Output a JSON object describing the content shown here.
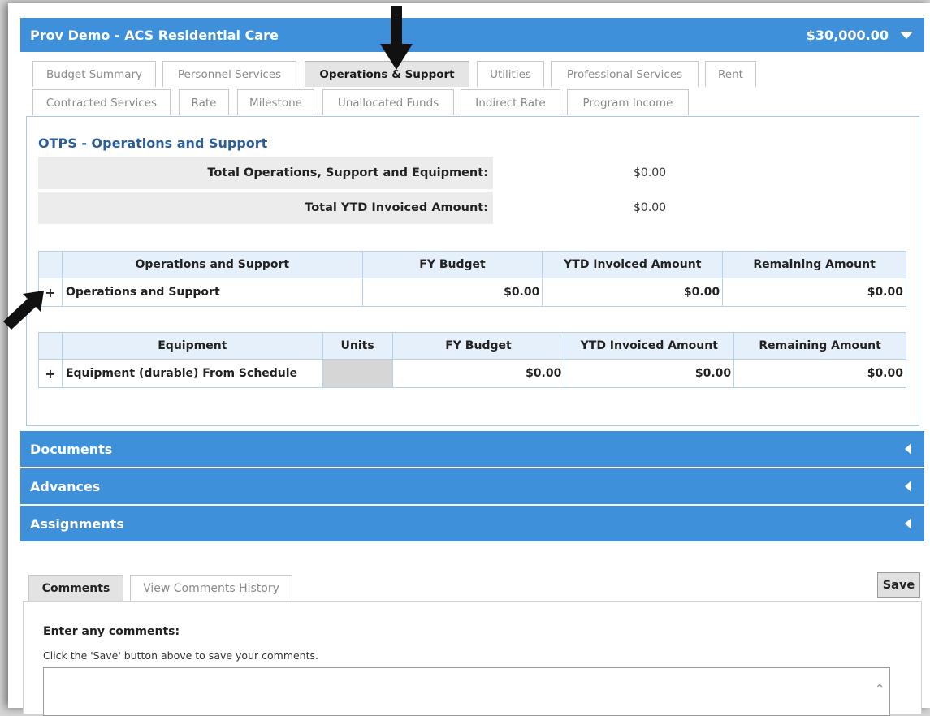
{
  "header": {
    "title": "Prov Demo - ACS Residential Care",
    "amount": "$30,000.00"
  },
  "tabs_row1": [
    "Budget Summary",
    "Personnel Services",
    "Operations & Support",
    "Utilities",
    "Professional Services",
    "Rent"
  ],
  "tabs_row2": [
    "Contracted Services",
    "Rate",
    "Milestone",
    "Unallocated Funds",
    "Indirect Rate",
    "Program Income"
  ],
  "active_tab": "Operations & Support",
  "section": {
    "title": "OTPS - Operations and Support",
    "total_ops_label": "Total Operations, Support and Equipment:",
    "total_ops_value": "$0.00",
    "total_ytd_label": "Total YTD Invoiced Amount:",
    "total_ytd_value": "$0.00"
  },
  "ops_table": {
    "headers": [
      "Operations and Support",
      "FY Budget",
      "YTD Invoiced Amount",
      "Remaining Amount"
    ],
    "row": {
      "expand": "+",
      "label": "Operations and Support",
      "fy_budget": "$0.00",
      "ytd": "$0.00",
      "remaining": "$0.00"
    }
  },
  "equip_table": {
    "headers": [
      "Equipment",
      "Units",
      "FY Budget",
      "YTD Invoiced Amount",
      "Remaining Amount"
    ],
    "row": {
      "expand": "+",
      "label": "Equipment (durable) From Schedule",
      "units": "",
      "fy_budget": "$0.00",
      "ytd": "$0.00",
      "remaining": "$0.00"
    }
  },
  "collapsed_sections": [
    "Documents",
    "Advances",
    "Assignments"
  ],
  "comments": {
    "tab_active": "Comments",
    "tab_history": "View Comments History",
    "save_label": "Save",
    "enter_label": "Enter any comments:",
    "hint": "Click the 'Save' button above to save your comments.",
    "value": ""
  },
  "colors": {
    "accent": "#3f90db",
    "title_blue": "#2b5d99",
    "header_bg": "#e6f0fa"
  }
}
